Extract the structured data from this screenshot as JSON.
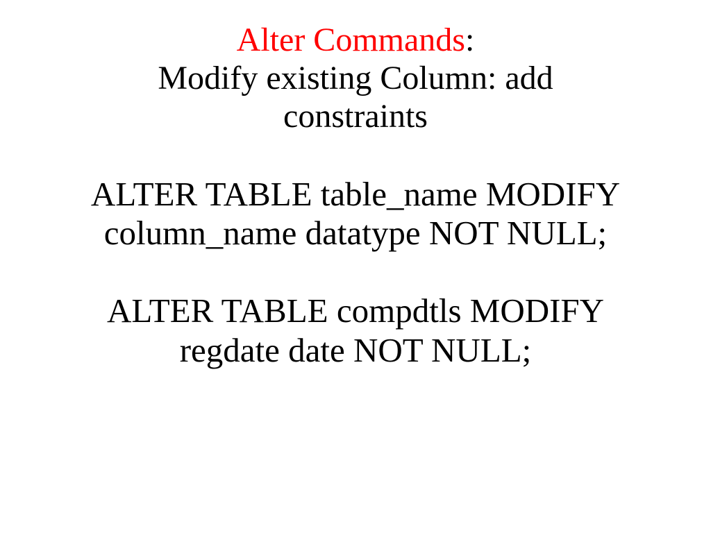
{
  "title": {
    "red_part": "Alter Commands",
    "colon": ":"
  },
  "subtitle": {
    "line1": "Modify existing Column: add",
    "line2": "constraints"
  },
  "syntax": {
    "line1": "ALTER TABLE table_name MODIFY",
    "line2": "column_name datatype NOT NULL;"
  },
  "example": {
    "line1": "ALTER TABLE compdtls MODIFY",
    "line2": "regdate date NOT NULL;"
  }
}
